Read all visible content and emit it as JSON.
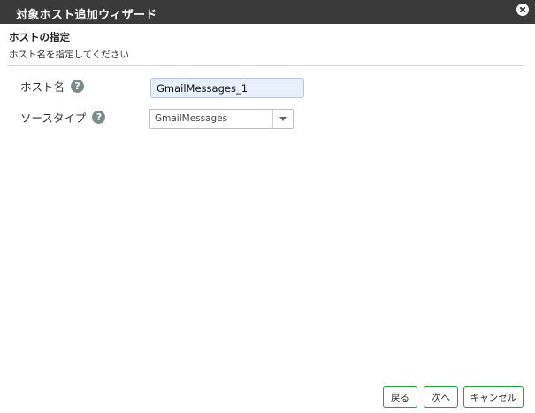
{
  "window": {
    "title": "対象ホスト追加ウィザード",
    "close_icon": "close-circle-icon"
  },
  "section": {
    "title": "ホストの指定",
    "description": "ホスト名を指定してください"
  },
  "form": {
    "host_name": {
      "label": "ホスト名",
      "value": "GmailMessages_1",
      "help_icon": "question-circle-icon",
      "help_glyph": "?"
    },
    "source_type": {
      "label": "ソースタイプ",
      "selected": "GmailMessages",
      "help_icon": "question-circle-icon",
      "help_glyph": "?"
    }
  },
  "footer": {
    "back_label": "戻る",
    "next_label": "次へ",
    "cancel_label": "キャンセル"
  },
  "colors": {
    "titlebar": "#3a3a3a",
    "button_border": "#2f9a4c",
    "input_bg": "#e8f0fb"
  }
}
